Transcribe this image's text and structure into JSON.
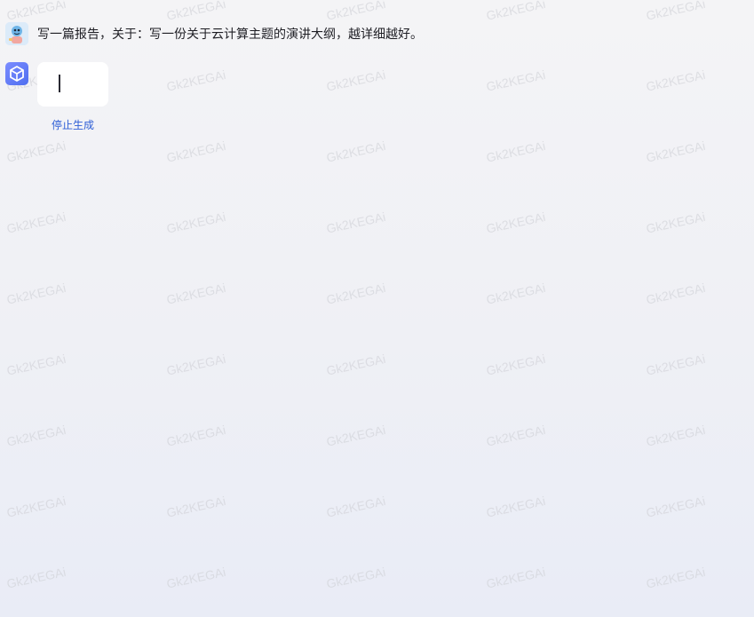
{
  "conversation": {
    "user_message": "写一篇报告，关于：写一份关于云计算主题的演讲大纲，越详细越好。",
    "bot_reply": "",
    "stop_label": "停止生成"
  },
  "watermark": {
    "text": "Gk2KEGAi"
  },
  "icons": {
    "user_avatar": "cartoon-avatar-icon",
    "bot_avatar": "cube-logo-icon",
    "cursor": "typing-cursor"
  },
  "colors": {
    "link": "#2f5fd6",
    "bot_avatar_accent": "#5b73f2",
    "bubble": "#ffffff"
  }
}
